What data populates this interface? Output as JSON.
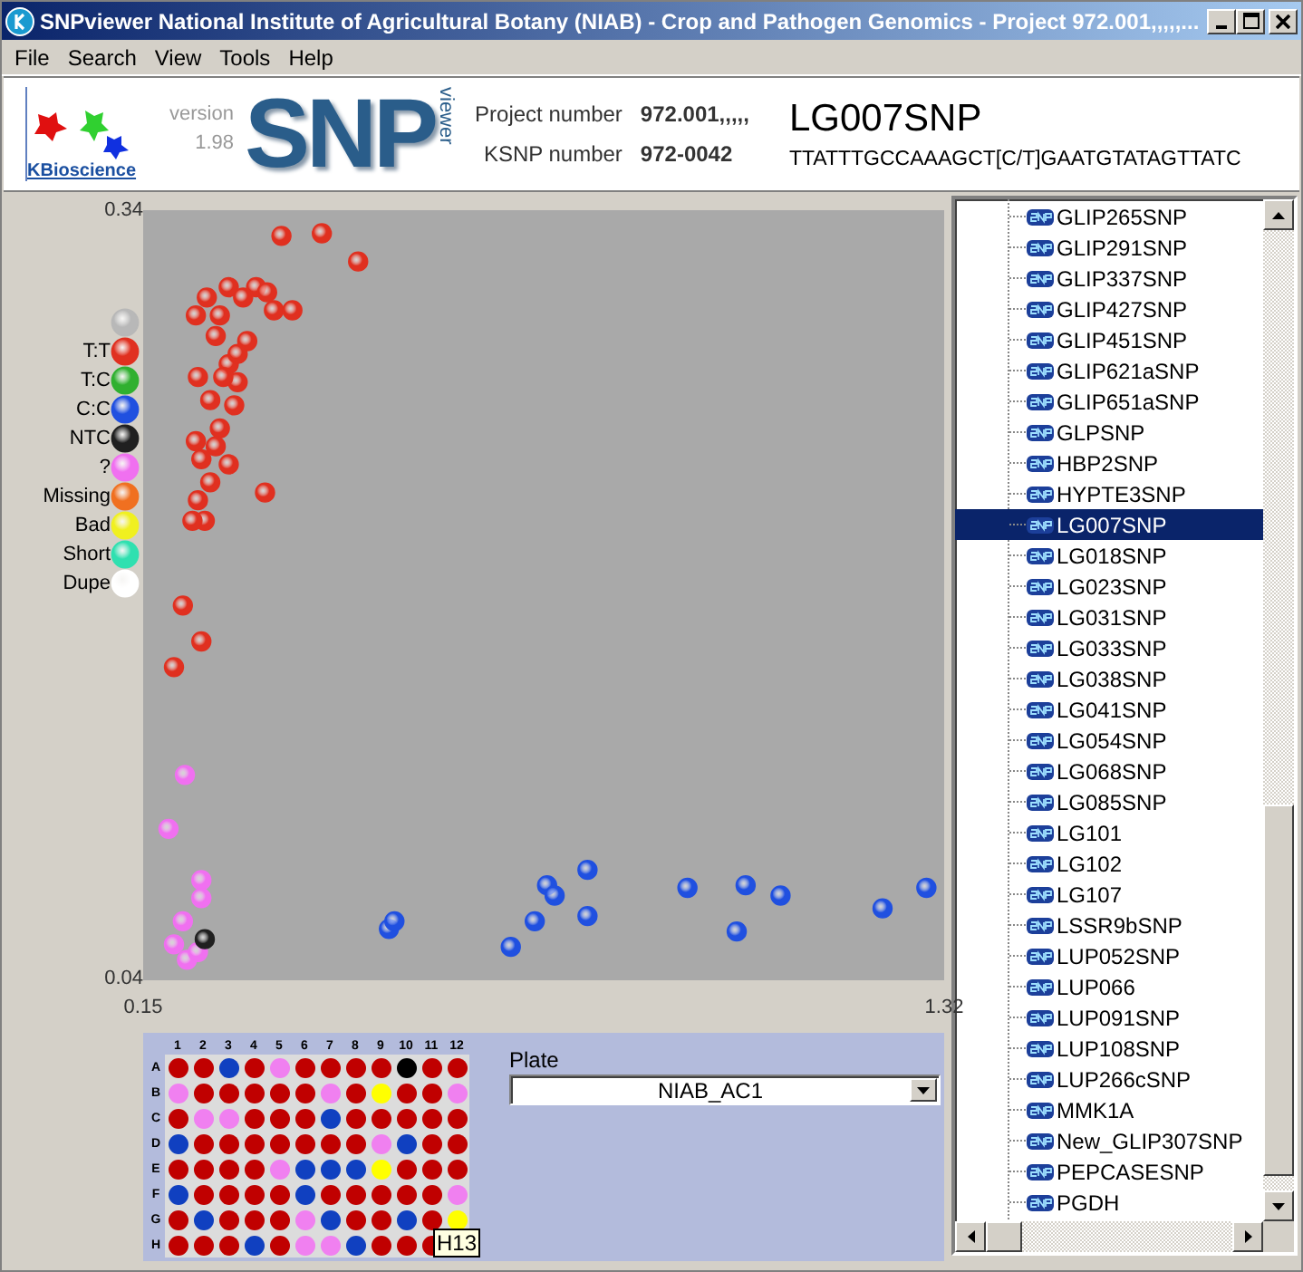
{
  "window": {
    "title": "SNPviewer   National Institute of Agricultural Botany (NIAB) - Crop and Pathogen Genomics - Project 972.001,,,,,..."
  },
  "menu": [
    "File",
    "Search",
    "View",
    "Tools",
    "Help"
  ],
  "header": {
    "company": "KBioscience",
    "version_label": "version",
    "version": "1.98",
    "logo_text": "SNP",
    "logo_sub": "viewer",
    "project_label": "Project number",
    "project": "972.001,,,,,",
    "ksnp_label": "KSNP number",
    "ksnp": "972-0042",
    "snp_name": "LG007SNP",
    "sequence": "TTATTTGCCAAAGCT[C/T]GAATGTATAGTTATC"
  },
  "legend": [
    {
      "color": "#b8b8b8"
    },
    {
      "label": "T:T",
      "color": "#e03020"
    },
    {
      "label": "T:C",
      "color": "#30b030"
    },
    {
      "label": "C:C",
      "color": "#2050e0"
    },
    {
      "label": "NTC",
      "color": "#202020"
    },
    {
      "label": "?",
      "color": "#f070f0"
    },
    {
      "label": "Missing",
      "color": "#f07020"
    },
    {
      "label": "Bad",
      "color": "#f0f020"
    },
    {
      "label": "Short",
      "color": "#30e0b0"
    },
    {
      "label": "Dupe",
      "color": "#ffffff"
    }
  ],
  "chart_data": {
    "type": "scatter",
    "xlim": [
      0.15,
      1.32
    ],
    "ylim": [
      0.04,
      0.34
    ],
    "xticks": [
      0.15,
      1.32
    ],
    "yticks": [
      0.04,
      0.34
    ],
    "series": [
      {
        "color": "#e03020",
        "x": [
          0.352,
          0.411,
          0.464,
          0.315,
          0.275,
          0.243,
          0.296,
          0.331,
          0.368,
          0.341,
          0.227,
          0.262,
          0.256,
          0.302,
          0.23,
          0.275,
          0.288,
          0.248,
          0.283,
          0.262,
          0.227,
          0.256,
          0.235,
          0.275,
          0.248,
          0.23,
          0.328,
          0.24,
          0.222,
          0.208,
          0.235,
          0.195,
          0.288,
          0.267
        ],
        "values": [
          0.33,
          0.331,
          0.32,
          0.31,
          0.31,
          0.306,
          0.306,
          0.308,
          0.301,
          0.301,
          0.299,
          0.299,
          0.291,
          0.289,
          0.275,
          0.28,
          0.273,
          0.266,
          0.264,
          0.255,
          0.25,
          0.248,
          0.243,
          0.241,
          0.234,
          0.227,
          0.23,
          0.219,
          0.219,
          0.186,
          0.172,
          0.162,
          0.284,
          0.275
        ]
      },
      {
        "color": "#2050e0",
        "x": [
          0.509,
          0.517,
          0.687,
          0.722,
          0.74,
          0.751,
          0.799,
          0.799,
          0.945,
          1.017,
          1.03,
          1.081,
          1.23,
          1.294
        ],
        "values": [
          0.06,
          0.063,
          0.053,
          0.063,
          0.077,
          0.073,
          0.083,
          0.065,
          0.076,
          0.059,
          0.077,
          0.073,
          0.068,
          0.076
        ]
      },
      {
        "color": "#f070f0",
        "x": [
          0.211,
          0.187,
          0.235,
          0.235,
          0.208,
          0.195,
          0.214,
          0.23
        ],
        "values": [
          0.12,
          0.099,
          0.079,
          0.072,
          0.063,
          0.054,
          0.048,
          0.051
        ]
      },
      {
        "color": "#202020",
        "x": [
          0.24
        ],
        "values": [
          0.056
        ]
      }
    ]
  },
  "plate": {
    "columns": [
      "1",
      "2",
      "3",
      "4",
      "5",
      "6",
      "7",
      "8",
      "9",
      "10",
      "11",
      "12"
    ],
    "rows": [
      {
        "label": "A",
        "wells": [
          {
            "color": "#c00000"
          },
          {
            "color": "#c00000"
          },
          {
            "color": "#1040c0"
          },
          {
            "color": "#c00000"
          },
          {
            "color": "#f080f0"
          },
          {
            "color": "#c00000"
          },
          {
            "color": "#c00000"
          },
          {
            "color": "#c00000"
          },
          {
            "color": "#c00000"
          },
          {
            "color": "#000000"
          },
          {
            "color": "#c00000"
          },
          {
            "color": "#c00000"
          }
        ]
      },
      {
        "label": "B",
        "wells": [
          {
            "color": "#f080f0"
          },
          {
            "color": "#c00000"
          },
          {
            "color": "#c00000"
          },
          {
            "color": "#c00000"
          },
          {
            "color": "#c00000"
          },
          {
            "color": "#c00000"
          },
          {
            "color": "#f080f0"
          },
          {
            "color": "#c00000"
          },
          {
            "color": "#ffff00"
          },
          {
            "color": "#c00000"
          },
          {
            "color": "#c00000"
          },
          {
            "color": "#f080f0"
          }
        ]
      },
      {
        "label": "C",
        "wells": [
          {
            "color": "#c00000"
          },
          {
            "color": "#f080f0"
          },
          {
            "color": "#f080f0"
          },
          {
            "color": "#c00000"
          },
          {
            "color": "#c00000"
          },
          {
            "color": "#c00000"
          },
          {
            "color": "#1040c0"
          },
          {
            "color": "#c00000"
          },
          {
            "color": "#c00000"
          },
          {
            "color": "#c00000"
          },
          {
            "color": "#c00000"
          },
          {
            "color": "#c00000"
          }
        ]
      },
      {
        "label": "D",
        "wells": [
          {
            "color": "#1040c0"
          },
          {
            "color": "#c00000"
          },
          {
            "color": "#c00000"
          },
          {
            "color": "#c00000"
          },
          {
            "color": "#c00000"
          },
          {
            "color": "#c00000"
          },
          {
            "color": "#c00000"
          },
          {
            "color": "#c00000"
          },
          {
            "color": "#f080f0"
          },
          {
            "color": "#1040c0"
          },
          {
            "color": "#c00000"
          },
          {
            "color": "#c00000"
          }
        ]
      },
      {
        "label": "E",
        "wells": [
          {
            "color": "#c00000"
          },
          {
            "color": "#c00000"
          },
          {
            "color": "#c00000"
          },
          {
            "color": "#c00000"
          },
          {
            "color": "#f080f0"
          },
          {
            "color": "#1040c0"
          },
          {
            "color": "#1040c0"
          },
          {
            "color": "#1040c0"
          },
          {
            "color": "#ffff00"
          },
          {
            "color": "#c00000"
          },
          {
            "color": "#c00000"
          },
          {
            "color": "#c00000"
          }
        ]
      },
      {
        "label": "F",
        "wells": [
          {
            "color": "#1040c0"
          },
          {
            "color": "#c00000"
          },
          {
            "color": "#c00000"
          },
          {
            "color": "#c00000"
          },
          {
            "color": "#c00000"
          },
          {
            "color": "#1040c0"
          },
          {
            "color": "#c00000"
          },
          {
            "color": "#c00000"
          },
          {
            "color": "#c00000"
          },
          {
            "color": "#c00000"
          },
          {
            "color": "#c00000"
          },
          {
            "color": "#f080f0"
          }
        ]
      },
      {
        "label": "G",
        "wells": [
          {
            "color": "#c00000"
          },
          {
            "color": "#1040c0"
          },
          {
            "color": "#c00000"
          },
          {
            "color": "#c00000"
          },
          {
            "color": "#c00000"
          },
          {
            "color": "#f080f0"
          },
          {
            "color": "#1040c0"
          },
          {
            "color": "#c00000"
          },
          {
            "color": "#c00000"
          },
          {
            "color": "#1040c0"
          },
          {
            "color": "#c00000"
          },
          {
            "color": "#ffff00"
          }
        ]
      },
      {
        "label": "H",
        "wells": [
          {
            "color": "#c00000"
          },
          {
            "color": "#c00000"
          },
          {
            "color": "#c00000"
          },
          {
            "color": "#1040c0"
          },
          {
            "color": "#c00000"
          },
          {
            "color": "#f080f0"
          },
          {
            "color": "#f080f0"
          },
          {
            "color": "#1040c0"
          },
          {
            "color": "#c00000"
          },
          {
            "color": "#c00000"
          },
          {
            "color": "#c00000"
          }
        ]
      }
    ],
    "tooltip": "H13",
    "plate_label": "Plate",
    "plate_value": "NIAB_AC1"
  },
  "snp_list": [
    {
      "label": "GLIP265SNP",
      "selected": false
    },
    {
      "label": "GLIP291SNP",
      "selected": false
    },
    {
      "label": "GLIP337SNP",
      "selected": false
    },
    {
      "label": "GLIP427SNP",
      "selected": false
    },
    {
      "label": "GLIP451SNP",
      "selected": false
    },
    {
      "label": "GLIP621aSNP",
      "selected": false
    },
    {
      "label": "GLIP651aSNP",
      "selected": false
    },
    {
      "label": "GLPSNP",
      "selected": false
    },
    {
      "label": "HBP2SNP",
      "selected": false
    },
    {
      "label": "HYPTE3SNP",
      "selected": false
    },
    {
      "label": "LG007SNP",
      "selected": true
    },
    {
      "label": "LG018SNP",
      "selected": false
    },
    {
      "label": "LG023SNP",
      "selected": false
    },
    {
      "label": "LG031SNP",
      "selected": false
    },
    {
      "label": "LG033SNP",
      "selected": false
    },
    {
      "label": "LG038SNP",
      "selected": false
    },
    {
      "label": "LG041SNP",
      "selected": false
    },
    {
      "label": "LG054SNP",
      "selected": false
    },
    {
      "label": "LG068SNP",
      "selected": false
    },
    {
      "label": "LG085SNP",
      "selected": false
    },
    {
      "label": "LG101",
      "selected": false
    },
    {
      "label": "LG102",
      "selected": false
    },
    {
      "label": "LG107",
      "selected": false
    },
    {
      "label": "LSSR9bSNP",
      "selected": false
    },
    {
      "label": "LUP052SNP",
      "selected": false
    },
    {
      "label": "LUP066",
      "selected": false
    },
    {
      "label": "LUP091SNP",
      "selected": false
    },
    {
      "label": "LUP108SNP",
      "selected": false
    },
    {
      "label": "LUP266cSNP",
      "selected": false
    },
    {
      "label": "MMK1A",
      "selected": false
    },
    {
      "label": "New_GLIP307SNP",
      "selected": false
    },
    {
      "label": "PEPCASESNP",
      "selected": false
    },
    {
      "label": "PGDH",
      "selected": false
    }
  ]
}
